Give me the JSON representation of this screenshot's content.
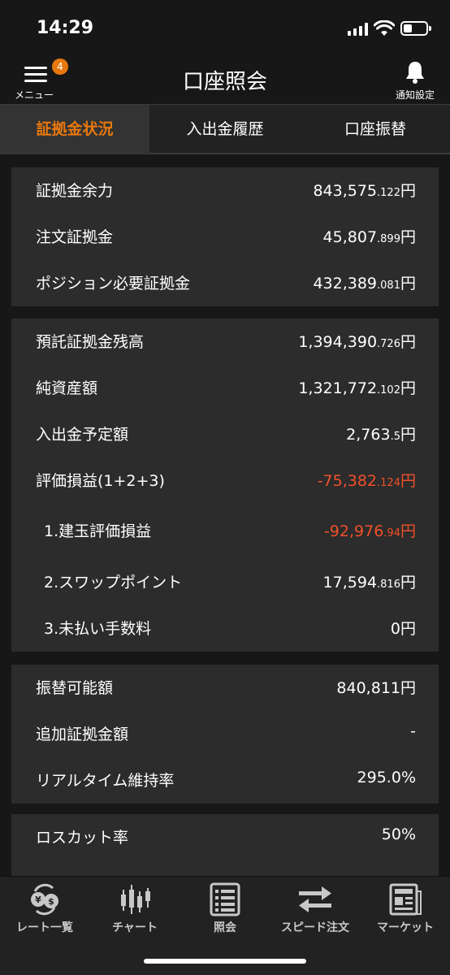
{
  "status": {
    "time": "14:29"
  },
  "header": {
    "title": "口座照会",
    "menu_label": "メニュー",
    "menu_badge": "4",
    "notify_label": "通知設定"
  },
  "tabs": [
    {
      "label": "証拠金状況",
      "active": true
    },
    {
      "label": "入出金履歴",
      "active": false
    },
    {
      "label": "口座振替",
      "active": false
    }
  ],
  "margin": {
    "rows": [
      {
        "label": "証拠金余力",
        "int": "843,575",
        "dec": ".122",
        "unit": "円"
      },
      {
        "label": "注文証拠金",
        "int": "45,807",
        "dec": ".899",
        "unit": "円"
      },
      {
        "label": "ポジション必要証拠金",
        "int": "432,389",
        "dec": ".081",
        "unit": "円"
      }
    ]
  },
  "balance": {
    "rows": [
      {
        "label": "預託証拠金残高",
        "int": "1,394,390",
        "dec": ".726",
        "unit": "円"
      },
      {
        "label": "純資産額",
        "int": "1,321,772",
        "dec": ".102",
        "unit": "円"
      },
      {
        "label": "入出金予定額",
        "int": "2,763",
        "dec": ".5",
        "unit": "円"
      },
      {
        "label": "評価損益(1+2+3)",
        "int": "-75,382",
        "dec": ".124",
        "unit": "円"
      },
      {
        "label": "1.建玉評価損益",
        "int": "-92,976",
        "dec": ".94",
        "unit": "円"
      },
      {
        "label": "2.スワップポイント",
        "int": "17,594",
        "dec": ".816",
        "unit": "円"
      },
      {
        "label": "3.未払い手数料",
        "int": "0",
        "dec": "",
        "unit": "円"
      }
    ]
  },
  "transfer": {
    "rows": [
      {
        "label": "振替可能額",
        "value": "840,811円"
      },
      {
        "label": "追加証拠金額",
        "value": "-"
      },
      {
        "label": "リアルタイム維持率",
        "value": "295.0%"
      }
    ]
  },
  "losscut": {
    "rows": [
      {
        "label": "ロスカット率",
        "value": "50%"
      }
    ]
  },
  "bottom_nav": [
    {
      "label": "レート一覧",
      "icon": "currency-exchange-icon"
    },
    {
      "label": "チャート",
      "icon": "candlestick-chart-icon"
    },
    {
      "label": "照会",
      "icon": "list-document-icon"
    },
    {
      "label": "スピード注文",
      "icon": "swap-arrows-icon"
    },
    {
      "label": "マーケット",
      "icon": "newspaper-icon"
    }
  ],
  "colors": {
    "accent": "#e8780e",
    "negative": "#f0502a",
    "background": "#171717",
    "card": "#2c2c2c"
  }
}
